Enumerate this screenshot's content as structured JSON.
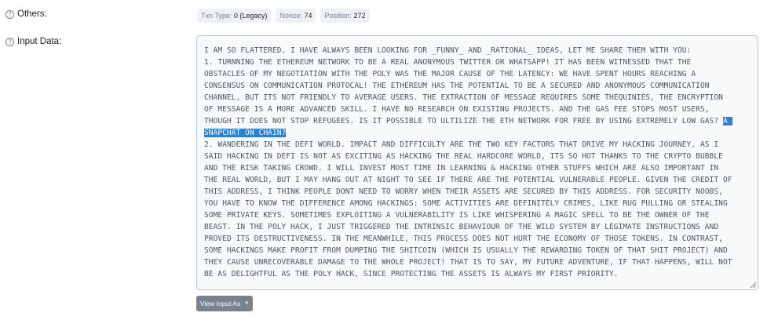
{
  "others": {
    "label": "Others:",
    "help_icon": "question-circle-icon",
    "badges": [
      {
        "key": "Txn Type:",
        "value": "0 (Legacy)"
      },
      {
        "key": "Nonce:",
        "value": "74"
      },
      {
        "key": "Position:",
        "value": "272"
      }
    ]
  },
  "input_data": {
    "label": "Input Data:",
    "help_icon": "question-circle-icon",
    "lines": [
      "I AM SO FLATTERED. I HAVE ALWAYS BEEN LOOKING FOR _FUNNY_ AND _RATIONAL_ IDEAS, LET ME SHARE THEM WITH YOU:",
      "1. TURNNING THE ETHEREUM NETWORK TO BE A REAL ANONYMOUS TWITTER OR WHATSAPP! IT HAS BEEN WITNESSED THAT THE",
      "OBSTACLES OF MY NEGOTIATION WITH THE POLY WAS THE MAJOR CAUSE OF THE LATENCY: WE HAVE SPENT HOURS REACHING A",
      "CONSENSUS ON COMMUNICATION PROTOCAL! THE ETHEREUM HAS THE POTENTIAL TO BE A SECURED AND ANONYMOUS COMMUNICATION",
      "CHANNEL, BUT ITS NOT FRIENDLY TO AVERAGE USERS. THE EXTRACTION OF MESSAGE REQUIRES SOME THEQUINIES, THE ENCRYPTION",
      "OF MESSAGE IS A MORE ADVANCED SKILL. I HAVE NO RESEARCH ON EXISTING PROJECTS. AND THE GAS FEE STOPS MOST USERS,"
    ],
    "line7_prefix": "THOUGH IT DOES NOT STOP REFUGEES. IS IT POSSIBLE TO ULTILIZE THE ETH NETWORK FOR FREE BY USING EXTREMELY LOW GAS? ",
    "line7_selected": "A ",
    "line8_selected": "SNAPCHAT ON CHAIN?",
    "lines_after": [
      "2. WANDERING IN THE DEFI WORLD. IMPACT AND DIFFICULTY ARE THE TWO KEY FACTORS THAT DRIVE MY HACKING JOURNEY. AS I",
      "SAID HACKING IN DEFI IS NOT AS EXCITING AS HACKING THE REAL HARDCORE WORLD, ITS SO HOT THANKS TO THE CRYPTO BUBBLE",
      "AND THE RISK TAKING CROWD. I WILL INVEST MOST TIME IN LEARNING & HACKING OTHER STUFFS WHICH ARE ALSO IMPORTANT IN",
      "THE REAL WORLD, BUT I MAY HANG OUT AT NIGHT TO SEE IF THERE ARE THE POTENTIAL VULNERABLE PEOPLE. GIVEN THE CREDIT OF",
      "THIS ADDRESS, I THINK PEOPLE DONT NEED TO WORRY WHEN THEIR ASSETS ARE SECURED BY THIS ADDRESS. FOR SECURITY NOOBS,",
      "YOU HAVE TO KNOW THE DIFFERENCE AMONG HACKINGS: SOME ACTIVITIES ARE DEFINITELY CRIMES, LIKE RUG PULLING OR STEALING",
      "SOME PRIVATE KEYS. SOMETIMES EXPLOITING A VULNERABILITY IS LIKE WHISPERING A MAGIC SPELL TO BE THE OWNER OF THE",
      "BEAST. IN THE POLY HACK, I JUST TRIGGERED THE INTRINSIC BEHAVIOUR OF THE WILD SYSTEM BY LEGIMATE INSTRUCTIONS AND",
      "PROVED ITS DESTRUCTIVENESS. IN THE MEANWHILE, THIS PROCESS DOES NOT HURT THE ECONOMY OF THOSE TOKENS. IN CONTRAST,",
      "SOME HACKINGS MAKE PROFIT FROM DUMPING THE SHITCOIN (WHICH IS USUALLY THE REWARDING TOKEN OF THAT SHIT PROJECT) AND",
      "THEY CAUSE UNRECOVERABLE DAMAGE TO THE WHOLE PROJECT! THAT IS TO SAY, MY FUTURE ADVENTURE, IF THAT HAPPENS, WILL NOT",
      "BE AS DELIGHTFUL AS THE POLY HACK, SINCE PROTECTING THE ASSETS IS ALWAYS MY FIRST PRIORITY."
    ]
  },
  "view_input_button": {
    "label": "View Input As",
    "icon": "chevron-down-icon"
  },
  "colors": {
    "selection": "#2f7fd2",
    "button": "#77838f",
    "textarea_border": "#a6c8ec",
    "badge_bg": "#eef0f3"
  }
}
